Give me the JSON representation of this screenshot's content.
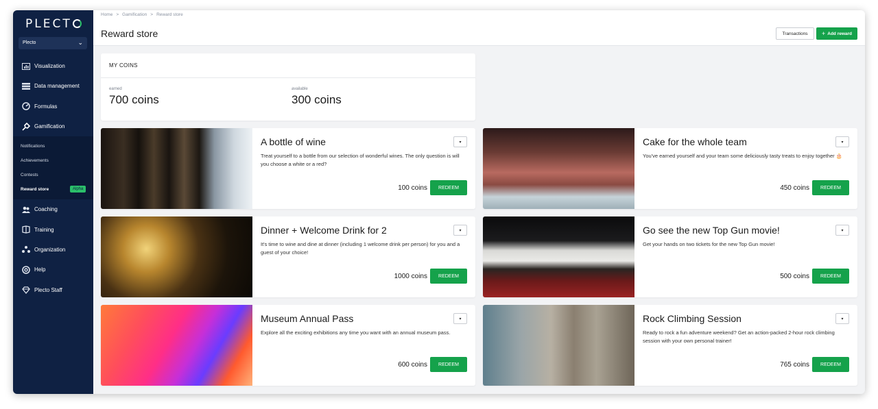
{
  "app": {
    "logo": "PLECT",
    "org": "Plecto"
  },
  "sidebar": {
    "items": [
      {
        "label": "Visualization",
        "icon": "chart-icon"
      },
      {
        "label": "Data management",
        "icon": "database-icon"
      },
      {
        "label": "Formulas",
        "icon": "gauge-icon"
      },
      {
        "label": "Gamification",
        "icon": "puzzle-icon"
      }
    ],
    "subitems": [
      {
        "label": "Notifications"
      },
      {
        "label": "Achievements"
      },
      {
        "label": "Contests"
      },
      {
        "label": "Reward store",
        "badge": "Alpha"
      }
    ],
    "items2": [
      {
        "label": "Coaching",
        "icon": "coaching-icon"
      },
      {
        "label": "Training",
        "icon": "training-icon"
      },
      {
        "label": "Organization",
        "icon": "organization-icon"
      },
      {
        "label": "Help",
        "icon": "help-icon"
      },
      {
        "label": "Plecto Staff",
        "icon": "diamond-icon"
      }
    ]
  },
  "header": {
    "breadcrumb": [
      "Home",
      "Gamification",
      "Reward store"
    ],
    "title": "Reward store",
    "transactions_label": "Transactions",
    "add_reward_label": "Add reward"
  },
  "coins": {
    "title": "MY COINS",
    "earned_label": "earned",
    "earned_value": "700 coins",
    "available_label": "available",
    "available_value": "300 coins"
  },
  "rewards": [
    {
      "title": "A bottle of wine",
      "desc": "Treat yourself to a bottle from our selection of wonderful wines. The only question is will you choose a white or a red?",
      "price": "100 coins",
      "redeem": "REDEEM",
      "image": "wine-bottles-image"
    },
    {
      "title": "Cake for the whole team",
      "desc": "You've earned yourself and your team some deliciously tasty treats to enjoy together 🎂",
      "price": "450 coins",
      "redeem": "REDEEM",
      "image": "cakes-image"
    },
    {
      "title": "Dinner + Welcome Drink for 2",
      "desc": "It's time to wine and dine at dinner (including 1 welcome drink per person) for you and a guest of your choice!",
      "price": "1000 coins",
      "redeem": "REDEEM",
      "image": "dinner-image"
    },
    {
      "title": "Go see the new Top Gun movie!",
      "desc": "Get your hands on two tickets for the new Top Gun movie!",
      "price": "500 coins",
      "redeem": "REDEEM",
      "image": "cinema-image"
    },
    {
      "title": "Museum Annual Pass",
      "desc": "Explore all the exciting exhibitions any time you want with an annual museum pass.",
      "price": "600 coins",
      "redeem": "REDEEM",
      "image": "museum-image"
    },
    {
      "title": "Rock Climbing Session",
      "desc": "Ready to rock a fun adventure weekend? Get an action-packed 2-hour rock climbing session with your own personal trainer!",
      "price": "765 coins",
      "redeem": "REDEEM",
      "image": "climbing-image"
    }
  ],
  "colors": {
    "sidebar": "#0f2143",
    "accent": "#15a24b",
    "alpha_badge": "#2bbf6a"
  }
}
